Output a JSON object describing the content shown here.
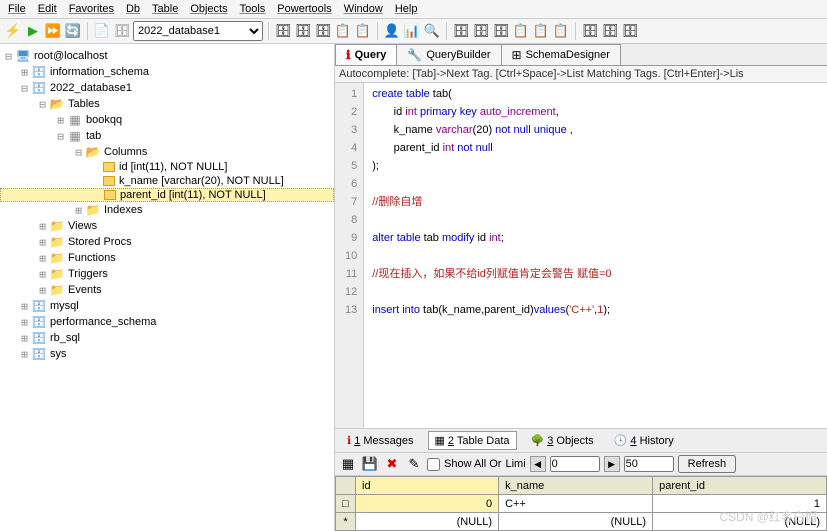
{
  "menu": {
    "items": [
      "File",
      "Edit",
      "Favorites",
      "Db",
      "Table",
      "Objects",
      "Tools",
      "Powertools",
      "Window",
      "Help"
    ]
  },
  "toolbar": {
    "db_selected": "2022_database1"
  },
  "tree": {
    "root": "root@localhost",
    "dbs": [
      {
        "name": "information_schema",
        "open": false
      },
      {
        "name": "2022_database1",
        "open": true,
        "children": [
          {
            "name": "Tables",
            "open": true,
            "type": "folder",
            "children": [
              {
                "name": "bookqq",
                "type": "table",
                "open": false
              },
              {
                "name": "tab",
                "type": "table",
                "open": true,
                "children": [
                  {
                    "name": "Columns",
                    "type": "folder",
                    "open": true,
                    "children": [
                      {
                        "name": "id [int(11), NOT NULL]",
                        "type": "col"
                      },
                      {
                        "name": "k_name [varchar(20), NOT NULL]",
                        "type": "col"
                      },
                      {
                        "name": "parent_id [int(11), NOT NULL]",
                        "type": "col",
                        "selected": true
                      }
                    ]
                  },
                  {
                    "name": "Indexes",
                    "type": "folder",
                    "open": false
                  }
                ]
              }
            ]
          },
          {
            "name": "Views",
            "type": "folder",
            "open": false
          },
          {
            "name": "Stored Procs",
            "type": "folder",
            "open": false
          },
          {
            "name": "Functions",
            "type": "folder",
            "open": false
          },
          {
            "name": "Triggers",
            "type": "folder",
            "open": false
          },
          {
            "name": "Events",
            "type": "folder",
            "open": false
          }
        ]
      },
      {
        "name": "mysql",
        "open": false
      },
      {
        "name": "performance_schema",
        "open": false
      },
      {
        "name": "rb_sql",
        "open": false
      },
      {
        "name": "sys",
        "open": false
      }
    ]
  },
  "query_tabs": [
    {
      "label": "Query",
      "active": true
    },
    {
      "label": "QueryBuilder",
      "active": false
    },
    {
      "label": "SchemaDesigner",
      "active": false
    }
  ],
  "autocomplete_hint": "Autocomplete: [Tab]->Next Tag. [Ctrl+Space]->List Matching Tags. [Ctrl+Enter]->Lis",
  "sql_lines": [
    "create table tab(",
    "       id int primary key auto_increment,",
    "       k_name varchar(20) not null unique ,",
    "       parent_id int not null",
    ");",
    "",
    "//删除自增",
    "",
    "alter table tab modify id int;",
    "",
    "//现在插入，如果不给id列赋值肯定会警告 赋值=0",
    "",
    "insert into tab(k_name,parent_id)values('C++',1);"
  ],
  "result_tabs": [
    {
      "num": "1",
      "label": "Messages"
    },
    {
      "num": "2",
      "label": "Table Data",
      "active": true
    },
    {
      "num": "3",
      "label": "Objects"
    },
    {
      "num": "4",
      "label": "History"
    }
  ],
  "grid_toolbar": {
    "show_all_or": "Show All Or",
    "limit_label": "Limi",
    "from": "0",
    "to": "50",
    "refresh": "Refresh"
  },
  "grid": {
    "columns": [
      "id",
      "k_name",
      "parent_id"
    ],
    "rows": [
      {
        "marker": "□",
        "id": "0",
        "k_name": "C++",
        "parent_id": "1"
      },
      {
        "marker": "*",
        "id": "(NULL)",
        "k_name": "(NULL)",
        "parent_id": "(NULL)"
      }
    ]
  },
  "watermark": "CSDN @红客白帽"
}
